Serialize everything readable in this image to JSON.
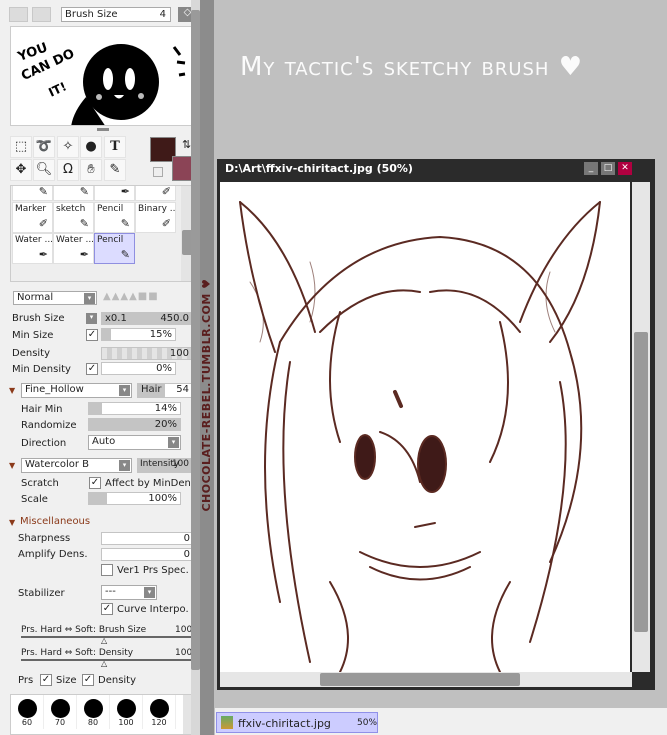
{
  "toolbar": {
    "brush_size_label": "Brush Size",
    "brush_size_value": "4"
  },
  "navigator": {
    "caption": "YOU CAN DO IT!"
  },
  "colors": {
    "primary": "#3f1a18",
    "secondary": "#8b4456",
    "accent": "#b00040"
  },
  "tools": [
    "selection-rect",
    "lasso",
    "magic-wand",
    "shape",
    "text",
    "move",
    "zoom",
    "rotate",
    "hand",
    "eyedropper"
  ],
  "brushes": {
    "row0": [
      "",
      "",
      "",
      ""
    ],
    "row1": [
      "Marker",
      "sketch",
      "Pencil",
      "Binary ..."
    ],
    "row2": [
      "Water ...",
      "Water ...",
      "Pencil",
      ""
    ],
    "selected": "Pencil"
  },
  "settings": {
    "blend_mode": "Normal",
    "brush_size": {
      "label": "Brush Size",
      "multiplier": "x0.1",
      "value": "450.0"
    },
    "min_size": {
      "label": "Min Size",
      "value": "15%",
      "fraction": 0.15
    },
    "density": {
      "label": "Density",
      "value": "100"
    },
    "min_density": {
      "label": "Min Density",
      "value": "0%"
    },
    "shape": {
      "name": "Fine_Hollow",
      "param_label": "Hair",
      "param_value": "54"
    },
    "hair_min": {
      "label": "Hair Min",
      "value": "14%",
      "fraction": 0.14
    },
    "randomize": {
      "label": "Randomize",
      "value": "20%",
      "fraction": 1.0
    },
    "direction": {
      "label": "Direction",
      "value": "Auto"
    },
    "texture": {
      "name": "Watercolor B",
      "param_label": "Intensity",
      "param_value": "100"
    },
    "scratch": {
      "label": "Scratch",
      "checkbox": "Affect by MinDens"
    },
    "scale": {
      "label": "Scale",
      "value": "100%",
      "fraction": 0.2
    },
    "misc_header": "Miscellaneous",
    "sharpness": {
      "label": "Sharpness",
      "value": "0"
    },
    "amplify": {
      "label": "Amplify Dens.",
      "value": "0"
    },
    "ver1": "Ver1 Prs Spec.",
    "stabilizer": {
      "label": "Stabilizer",
      "value": "---"
    },
    "curve": "Curve Interpo.",
    "prs_size": {
      "label": "Prs. Hard ⇔ Soft: Brush Size",
      "value": "100"
    },
    "prs_density": {
      "label": "Prs. Hard ⇔ Soft: Density",
      "value": "100"
    },
    "prs": {
      "label": "Prs",
      "size": "Size",
      "density": "Density"
    },
    "sizes": [
      "60",
      "70",
      "80",
      "100",
      "120"
    ]
  },
  "watermark": "CHOCOLATE-REBEL.TUMBLR.COM ♥",
  "banner": "My tactic's sketchy brush ♥",
  "document": {
    "title": "D:\\Art\\ffxiv-chiritact.jpg (50%)"
  },
  "taskbar": {
    "file": "ffxiv-chiritact.jpg",
    "zoom": "50%"
  }
}
